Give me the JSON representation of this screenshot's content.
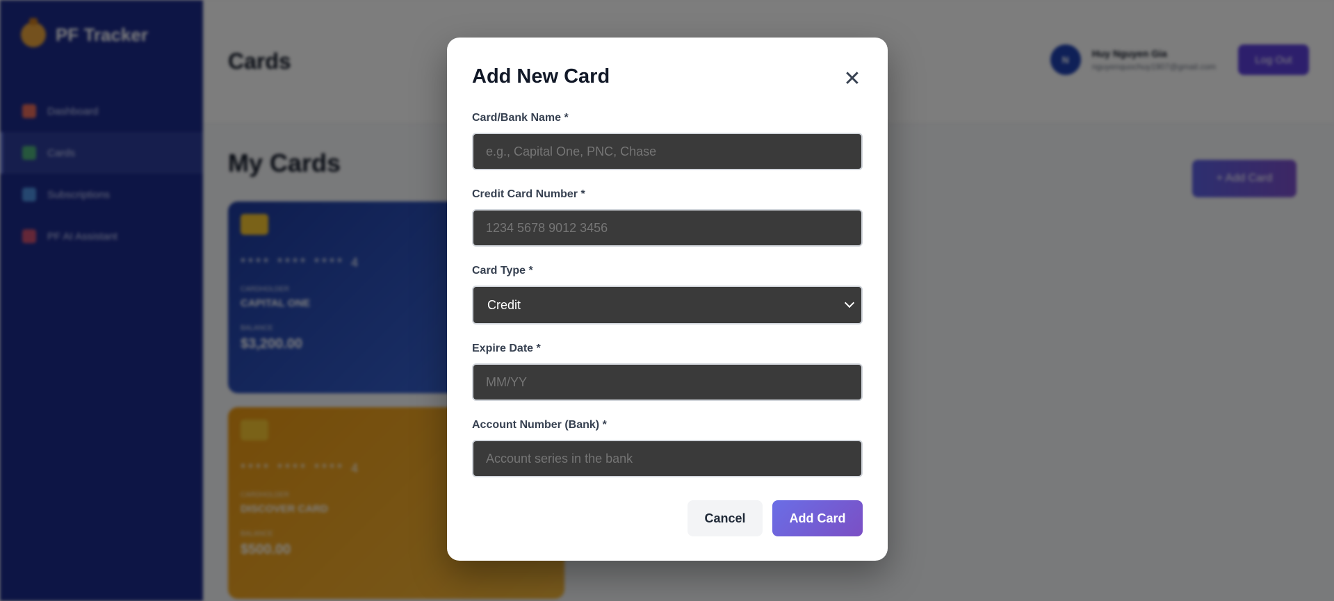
{
  "app": {
    "brand": "PF Tracker",
    "nav": [
      {
        "label": "Dashboard"
      },
      {
        "label": "Cards"
      },
      {
        "label": "Subscriptions"
      },
      {
        "label": "PF AI Assistant"
      }
    ],
    "page_title": "Cards",
    "user": {
      "initials": "N",
      "name": "Huy Nguyen Gia",
      "email": "nguyenquochuy1907@gmail.com"
    },
    "logout_label": "Log Out",
    "section_title": "My Cards",
    "add_card_label": "+ Add Card",
    "cards": [
      {
        "number": "**** **** **** 4",
        "holder_label": "CARDHOLDER",
        "holder": "CAPITAL ONE",
        "balance_label": "BALANCE",
        "balance": "$3,200.00"
      },
      {
        "number": "**** **** **** 4",
        "holder_label": "CARDHOLDER",
        "holder": "DISCOVER CARD",
        "balance_label": "BALANCE",
        "balance": "$500.00"
      }
    ]
  },
  "modal": {
    "title": "Add New Card",
    "close_icon": "close-icon",
    "fields": {
      "card_name": {
        "label": "Card/Bank Name *",
        "placeholder": "e.g., Capital One, PNC, Chase"
      },
      "card_number": {
        "label": "Credit Card Number *",
        "placeholder": "1234 5678 9012 3456"
      },
      "card_type": {
        "label": "Card Type *",
        "value": "Credit"
      },
      "expire_date": {
        "label": "Expire Date *",
        "placeholder": "MM/YY"
      },
      "account_number": {
        "label": "Account Number (Bank) *",
        "placeholder": "Account series in the bank"
      }
    },
    "cancel_label": "Cancel",
    "submit_label": "Add Card"
  },
  "colors": {
    "sidebar": "#1b2a8a",
    "accent": "#6a6ee6",
    "input_bg": "#3a3a3a"
  }
}
